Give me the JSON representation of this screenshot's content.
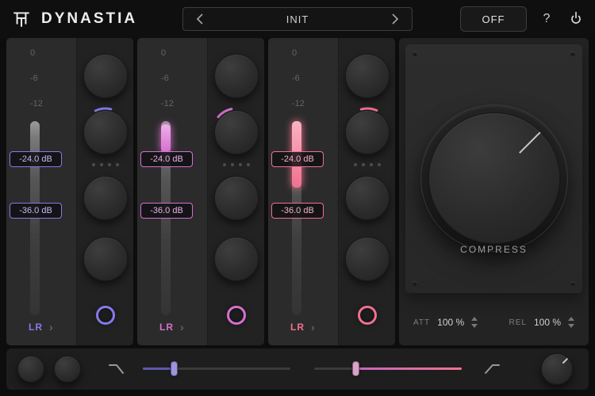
{
  "header": {
    "title": "DYNASTIA",
    "preset_name": "INIT",
    "bypass_label": "OFF",
    "help_label": "?"
  },
  "icons": {
    "chevron_right": "›"
  },
  "colors": {
    "band1": {
      "main": "#857ae8",
      "light": "#c0b9f3"
    },
    "band2": {
      "main": "#d66fd0",
      "light": "#eeb0e8"
    },
    "band3": {
      "main": "#ef7190",
      "light": "#f9b3c2"
    },
    "slider_low": {
      "main": "#5f58b0",
      "light": "#9c94dd"
    },
    "slider_high": {
      "main": "#c468be",
      "light": "#d8a3c6",
      "to": "#f0718f"
    }
  },
  "bands": [
    {
      "scale": [
        "0",
        "-6",
        "-12"
      ],
      "threshold_high": "-24.0 dB",
      "threshold_low": "-36.0 dB",
      "channel": "LR"
    },
    {
      "scale": [
        "0",
        "-6",
        "-12"
      ],
      "threshold_high": "-24.0 dB",
      "threshold_low": "-36.0 dB",
      "channel": "LR"
    },
    {
      "scale": [
        "0",
        "-6",
        "-12"
      ],
      "threshold_high": "-24.0 dB",
      "threshold_low": "-36.0 dB",
      "channel": "LR"
    }
  ],
  "compressor": {
    "label": "COMPRESS",
    "att_label": "ATT",
    "att_value": "100 %",
    "rel_label": "REL",
    "rel_value": "100 %"
  }
}
